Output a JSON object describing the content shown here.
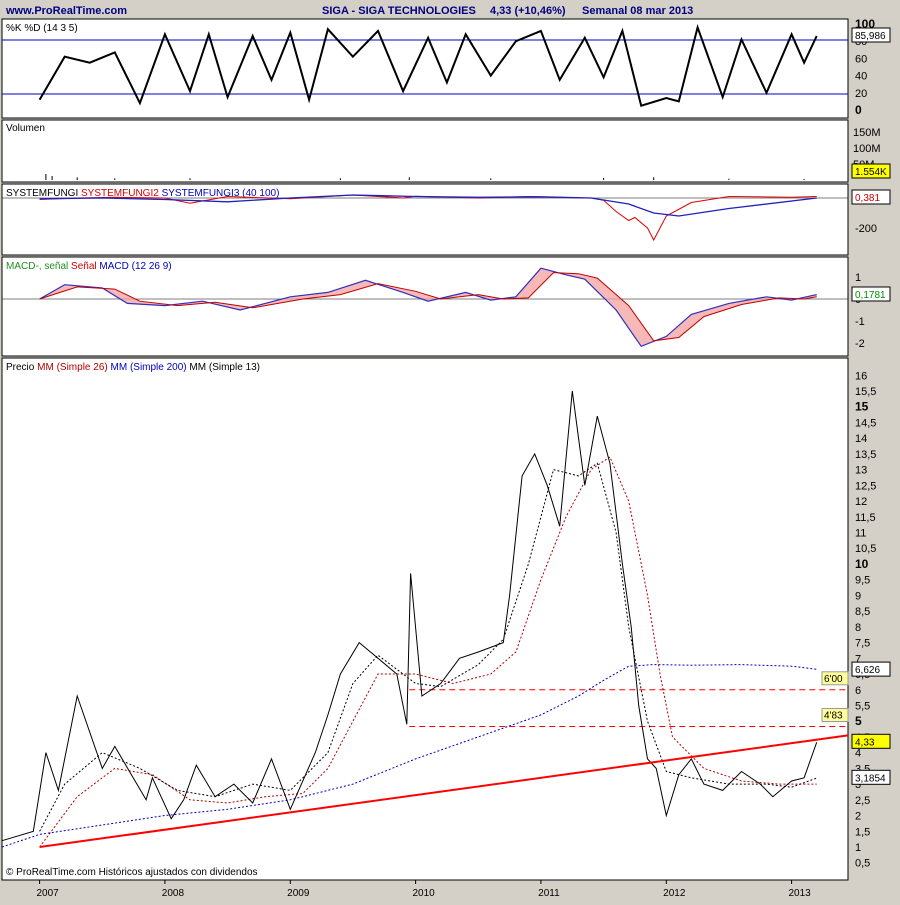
{
  "header": {
    "site": "www.ProRealTime.com",
    "title": "SIGA - SIGA TECHNOLOGIES",
    "quote": "4,33 (+10,46%)",
    "period": "Semanal  08 mar 2013"
  },
  "footer": {
    "credit": "© ProRealTime.com  Históricos ajustados con dividendos"
  },
  "colors": {
    "background": "#d4d0c8",
    "panel": "#ffffff",
    "price_line": "#000000",
    "trendline": "#ff0000",
    "resistance": "#ff0000",
    "ma26": "#b00000",
    "ma200": "#0000c0",
    "ma13": "#000000",
    "label_bg": "#ffff99"
  },
  "chart_data": [
    {
      "id": "stochastic",
      "type": "line",
      "title": "%K %D (14 3 5)",
      "ylim": [
        0,
        100
      ],
      "yticks": [
        "100",
        "80",
        "60",
        "40",
        "20",
        "0"
      ],
      "levels": [
        20,
        80
      ],
      "last_value": "85,986",
      "series": [
        {
          "name": "%K",
          "x": [
            2007.0,
            2007.2,
            2007.4,
            2007.6,
            2007.8,
            2008.0,
            2008.2,
            2008.35,
            2008.5,
            2008.7,
            2008.85,
            2009.0,
            2009.15,
            2009.3,
            2009.5,
            2009.7,
            2009.9,
            2010.1,
            2010.25,
            2010.4,
            2010.6,
            2010.8,
            2011.0,
            2011.15,
            2011.35,
            2011.5,
            2011.65,
            2011.8,
            2012.0,
            2012.1,
            2012.25,
            2012.45,
            2012.6,
            2012.8,
            2013.0,
            2013.1,
            2013.2
          ],
          "values": [
            12,
            62,
            55,
            67,
            8,
            88,
            22,
            88,
            15,
            86,
            35,
            90,
            12,
            94,
            62,
            92,
            22,
            84,
            32,
            88,
            40,
            80,
            92,
            35,
            84,
            38,
            92,
            5,
            14,
            10,
            96,
            15,
            82,
            20,
            88,
            55,
            86
          ]
        }
      ]
    },
    {
      "id": "volume",
      "type": "bar",
      "title": "Volumen",
      "yticks": [
        "150M",
        "100M",
        "50M"
      ],
      "last_value": "1.554K",
      "series": [
        {
          "name": "Volumen",
          "x": [
            2007.05,
            2007.1,
            2007.3,
            2007.6,
            2008.2,
            2009.4,
            2009.95,
            2010.6,
            2011.5,
            2011.9,
            2012.5,
            2013.1
          ],
          "values": [
            18,
            12,
            8,
            5,
            5,
            5,
            8,
            5,
            6,
            8,
            4,
            3
          ]
        }
      ]
    },
    {
      "id": "systemfungi",
      "type": "line",
      "title": "SYSTEMFUNGI SYSTEMFUNGI2 SYSTEMFUNGI3 (40 100)",
      "title_parts": [
        "SYSTEMFUNGI",
        "SYSTEMFUNGI2",
        "SYSTEMFUNGI3 (40 100)"
      ],
      "ylim": [
        -300,
        25
      ],
      "yticks": [
        "0",
        "-200"
      ],
      "last_value": "0,381",
      "series": [
        {
          "name": "SYSTEMFUNGI2",
          "x": [
            2007.0,
            2007.3,
            2007.6,
            2008.0,
            2008.2,
            2008.5,
            2009.0,
            2009.5,
            2009.9,
            2010.0,
            2010.5,
            2010.9,
            2011.1,
            2011.4,
            2011.5,
            2011.6,
            2011.7,
            2011.75,
            2011.85,
            2011.9,
            2012.0,
            2012.2,
            2012.5,
            2013.0,
            2013.2
          ],
          "values": [
            -10,
            0,
            5,
            0,
            -35,
            10,
            -5,
            20,
            0,
            12,
            0,
            10,
            5,
            0,
            -15,
            -90,
            -150,
            -130,
            -200,
            -280,
            -120,
            -30,
            10,
            5,
            10
          ]
        },
        {
          "name": "SYSTEMFUNGI3 (40 100)",
          "x": [
            2007.0,
            2007.5,
            2008.0,
            2008.5,
            2009.0,
            2009.5,
            2010.0,
            2010.5,
            2011.0,
            2011.4,
            2011.7,
            2011.9,
            2012.1,
            2012.5,
            2013.2
          ],
          "values": [
            -5,
            0,
            -10,
            -25,
            0,
            20,
            10,
            5,
            8,
            0,
            -40,
            -100,
            -120,
            -70,
            0
          ]
        }
      ]
    },
    {
      "id": "macd",
      "type": "line",
      "title": "MACD-, señal Señal MACD (12 26 9)",
      "title_parts": [
        "MACD-, señal",
        "Señal",
        "MACD (12 26 9)"
      ],
      "ylim": [
        -2.4,
        1.6
      ],
      "yticks": [
        "1",
        "0",
        "-1",
        "-2"
      ],
      "last_value": "0,1781",
      "series": [
        {
          "name": "MACD (12 26 9)",
          "x": [
            2007.0,
            2007.2,
            2007.5,
            2007.7,
            2008.0,
            2008.3,
            2008.6,
            2009.0,
            2009.3,
            2009.6,
            2009.9,
            2010.1,
            2010.4,
            2010.6,
            2010.8,
            2011.0,
            2011.2,
            2011.35,
            2011.6,
            2011.8,
            2012.0,
            2012.2,
            2012.5,
            2012.8,
            2013.0,
            2013.2
          ],
          "values": [
            0,
            0.65,
            0.5,
            -0.2,
            -0.3,
            -0.1,
            -0.5,
            0.1,
            0.3,
            0.85,
            0.3,
            -0.1,
            0.3,
            -0.05,
            0.1,
            1.4,
            1.1,
            0.9,
            -0.5,
            -2.15,
            -1.7,
            -0.7,
            -0.2,
            0.1,
            -0.05,
            0.2
          ]
        },
        {
          "name": "Señal",
          "x": [
            2007.0,
            2007.3,
            2007.6,
            2007.8,
            2008.1,
            2008.4,
            2008.7,
            2009.1,
            2009.4,
            2009.7,
            2010.0,
            2010.2,
            2010.5,
            2010.7,
            2010.9,
            2011.1,
            2011.3,
            2011.45,
            2011.7,
            2011.9,
            2012.1,
            2012.3,
            2012.6,
            2012.9,
            2013.1,
            2013.2
          ],
          "values": [
            0,
            0.55,
            0.45,
            -0.1,
            -0.3,
            -0.15,
            -0.4,
            0,
            0.2,
            0.7,
            0.35,
            0,
            0.2,
            0,
            0.05,
            1.2,
            1.15,
            0.95,
            -0.3,
            -1.9,
            -1.75,
            -0.8,
            -0.25,
            0.05,
            0,
            0.1
          ]
        }
      ]
    },
    {
      "id": "price",
      "type": "line",
      "title": "Precio MM (Simple 26) MM (Simple 200) MM (Simple 13)",
      "title_parts": [
        "Precio",
        "MM (Simple 26)",
        "MM (Simple 200)",
        "MM (Simple 13)"
      ],
      "ylim": [
        0,
        16.4
      ],
      "yticks": [
        "16",
        "15,5",
        "15",
        "14,5",
        "14",
        "13,5",
        "13",
        "12,5",
        "12",
        "11,5",
        "11",
        "10,5",
        "10",
        "9,5",
        "9",
        "8,5",
        "8",
        "7,5",
        "7",
        "6,5",
        "6",
        "5,5",
        "5",
        "4,5",
        "4",
        "3,5",
        "3",
        "2,5",
        "2",
        "1,5",
        "1",
        "0,5"
      ],
      "bold_ticks": [
        "15",
        "10",
        "5"
      ],
      "xlabels": [
        "2007",
        "2008",
        "2009",
        "2010",
        "2011",
        "2012",
        "2013"
      ],
      "xlim": [
        2006.7,
        2013.45
      ],
      "resistance_lines": [
        {
          "label": "6'00",
          "value": 6.0
        },
        {
          "label": "4'83",
          "value": 4.83
        }
      ],
      "trendline": {
        "x": [
          2007.0,
          2013.45
        ],
        "y": [
          1.0,
          4.55
        ]
      },
      "value_labels": [
        {
          "text": "6,626",
          "value": 6.626
        },
        {
          "text": "4,33",
          "value": 4.33
        },
        {
          "text": "3,1854",
          "value": 3.1854
        }
      ],
      "series": [
        {
          "name": "Precio",
          "x": [
            2006.7,
            2006.95,
            2007.05,
            2007.15,
            2007.3,
            2007.5,
            2007.6,
            2007.85,
            2007.9,
            2008.05,
            2008.15,
            2008.25,
            2008.4,
            2008.55,
            2008.7,
            2008.85,
            2009.0,
            2009.2,
            2009.3,
            2009.4,
            2009.55,
            2009.7,
            2009.85,
            2009.93,
            2009.96,
            2010.05,
            2010.2,
            2010.35,
            2010.5,
            2010.7,
            2010.75,
            2010.85,
            2010.95,
            2011.05,
            2011.15,
            2011.25,
            2011.35,
            2011.45,
            2011.55,
            2011.65,
            2011.72,
            2011.78,
            2011.85,
            2011.92,
            2012.0,
            2012.1,
            2012.2,
            2012.3,
            2012.45,
            2012.6,
            2012.75,
            2012.85,
            2013.0,
            2013.1,
            2013.2
          ],
          "values": [
            1.2,
            1.5,
            4.0,
            2.8,
            5.8,
            3.5,
            4.2,
            2.5,
            3.2,
            1.9,
            2.5,
            3.6,
            2.6,
            3.0,
            2.4,
            3.8,
            2.2,
            4.0,
            5.2,
            6.5,
            7.5,
            7.0,
            6.5,
            4.9,
            9.7,
            5.8,
            6.2,
            7.0,
            7.2,
            7.5,
            9.0,
            12.8,
            13.5,
            12.5,
            11.2,
            15.5,
            12.5,
            14.7,
            13.2,
            10.0,
            8.0,
            5.5,
            3.8,
            3.5,
            2.0,
            3.3,
            3.8,
            3.0,
            2.8,
            3.4,
            3.0,
            2.6,
            3.1,
            3.2,
            4.33
          ]
        },
        {
          "name": "MM (Simple 13)",
          "x": [
            2007.0,
            2007.2,
            2007.5,
            2007.8,
            2008.1,
            2008.4,
            2008.7,
            2009.0,
            2009.3,
            2009.5,
            2009.7,
            2010.0,
            2010.2,
            2010.5,
            2010.7,
            2010.9,
            2011.1,
            2011.3,
            2011.45,
            2011.6,
            2011.7,
            2011.85,
            2012.0,
            2012.2,
            2012.5,
            2012.8,
            2013.0,
            2013.2
          ],
          "values": [
            1.5,
            3.0,
            4.0,
            3.5,
            2.8,
            2.6,
            3.0,
            2.8,
            4.0,
            6.2,
            7.1,
            6.2,
            6.1,
            6.8,
            7.6,
            10.0,
            13.0,
            12.8,
            13.2,
            11.0,
            8.0,
            5.0,
            3.4,
            3.2,
            3.0,
            3.0,
            2.9,
            3.19
          ]
        },
        {
          "name": "MM (Simple 26)",
          "x": [
            2007.0,
            2007.3,
            2007.6,
            2007.9,
            2008.2,
            2008.5,
            2008.8,
            2009.1,
            2009.3,
            2009.5,
            2009.7,
            2010.0,
            2010.3,
            2010.6,
            2010.8,
            2011.0,
            2011.2,
            2011.4,
            2011.55,
            2011.7,
            2011.85,
            2011.95,
            2012.05,
            2012.3,
            2012.6,
            2012.9,
            2013.2
          ],
          "values": [
            1.0,
            2.6,
            3.5,
            3.3,
            2.5,
            2.4,
            2.6,
            2.7,
            3.5,
            5.0,
            6.5,
            6.5,
            6.2,
            6.5,
            7.2,
            9.5,
            11.5,
            13.0,
            13.4,
            12.0,
            9.0,
            6.5,
            4.5,
            3.5,
            3.1,
            3.0,
            3.0
          ]
        },
        {
          "name": "MM (Simple 200)",
          "x": [
            2006.7,
            2007.0,
            2007.5,
            2008.0,
            2008.5,
            2009.0,
            2009.5,
            2010.0,
            2010.5,
            2011.0,
            2011.3,
            2011.5,
            2011.7,
            2011.9,
            2012.2,
            2012.6,
            2013.0,
            2013.2
          ],
          "values": [
            1.0,
            1.4,
            1.7,
            2.0,
            2.2,
            2.5,
            3.0,
            3.8,
            4.5,
            5.2,
            5.8,
            6.3,
            6.75,
            6.8,
            6.78,
            6.8,
            6.75,
            6.65
          ]
        }
      ]
    }
  ]
}
